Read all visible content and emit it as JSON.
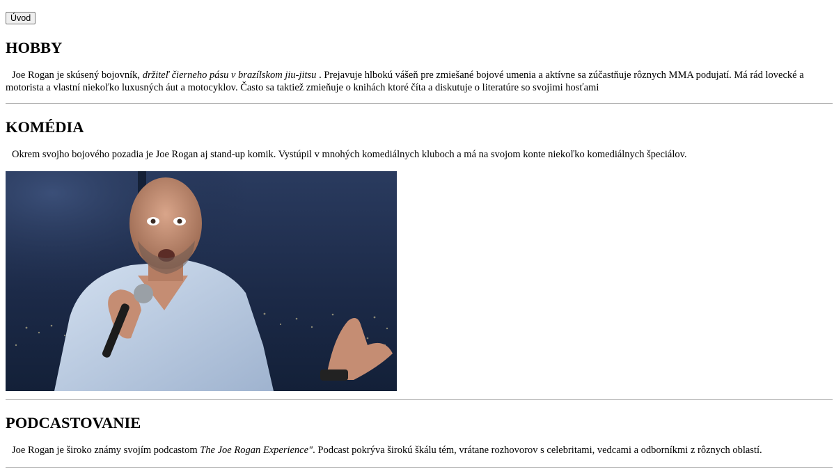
{
  "nav": {
    "intro_button": "Úvod"
  },
  "sections": {
    "hobby": {
      "heading": "HOBBY",
      "text_before": "Joe Rogan je skúsený bojovník, ",
      "text_em": "držiteľ čierneho pásu v brazílskom jiu-jitsu",
      "text_after": " . Prejavuje hlbokú vášeň pre zmiešané bojové umenia a aktívne sa zúčastňuje rôznych MMA podujatí. Má rád lovecké a motorista a vlastní niekoľko luxusných áut a motocyklov. Často sa taktiež zmieňuje o knihách ktoré číta a diskutuje o literatúre so svojimi hosťami"
    },
    "comedy": {
      "heading": "KOMÉDIA",
      "text": "Okrem svojho bojového pozadia je Joe Rogan aj stand-up komik. Vystúpil v mnohých komediálnych kluboch a má na svojom konte niekoľko komediálnych špeciálov."
    },
    "podcast": {
      "heading": "PODCASTOVANIE",
      "text_before": "Joe Rogan je široko známy svojím podcastom ",
      "text_em": "The Joe Rogan Experience\"",
      "text_after": ". Podcast pokrýva širokú škálu tém, vrátane rozhovorov s celebritami, vedcami a odborníkmi z rôznych oblastí."
    }
  },
  "colors": {
    "background": "#ffffff",
    "text": "#000000",
    "rule": "#a9a9a9",
    "button_bg": "#efefef",
    "button_border": "#767676",
    "photo_backdrop": "#1f2f4e",
    "photo_shirt": "#b9c9e0"
  }
}
